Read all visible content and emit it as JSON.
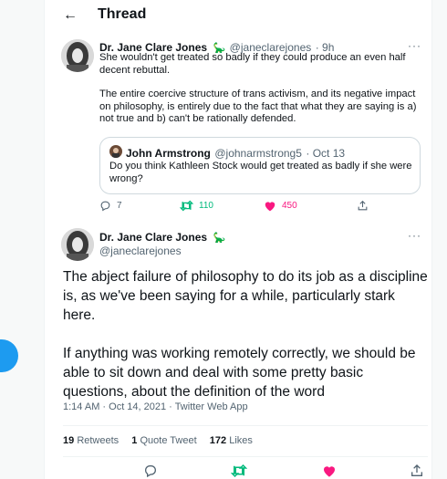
{
  "header": {
    "back_label": "←",
    "title": "Thread"
  },
  "tweet_parent": {
    "name": "Dr. Jane Clare Jones",
    "badge": "🦕",
    "handle": "@janeclarejones",
    "time": "· 9h",
    "more": "···",
    "paragraphs": [
      "She wouldn't get treated so badly if they could produce an even half decent rebuttal.",
      "The entire coercive structure of trans activism, and its negative impact on philosophy, is entirely due to the fact that what they are saying is a) not true and b) can't be rationally defended."
    ],
    "quote": {
      "name": "John Armstrong",
      "handle": "@johnarmstrong5",
      "time": "· Oct 13",
      "text": "Do you think Kathleen Stock would get treated as badly if she were wrong?"
    },
    "actions": {
      "replies": "7",
      "retweets": "110",
      "likes": "450"
    }
  },
  "tweet_main": {
    "name": "Dr. Jane Clare Jones",
    "badge": "🦕",
    "handle": "@janeclarejones",
    "more": "···",
    "paragraphs": [
      "The abject failure of philosophy to do its job as a discipline is, as we've been saying for a while, particularly stark here.",
      "If anything was working remotely correctly, we should be able to sit down and deal with some pretty basic questions, about the definition of the word"
    ],
    "meta": "1:14 AM · Oct 14, 2021 · Twitter Web App",
    "stats": {
      "retweets_count": "19",
      "retweets_label": "Retweets",
      "quotes_count": "1",
      "quotes_label": "Quote Tweet",
      "likes_count": "172",
      "likes_label": "Likes"
    }
  },
  "colors": {
    "accent": "#1d9bf0",
    "retweet": "#00ba7c",
    "like": "#f91880",
    "muted": "#536471"
  },
  "icons": [
    "back-arrow-icon",
    "reply-icon",
    "retweet-icon",
    "like-icon",
    "share-icon",
    "more-icon",
    "dinosaur-badge-icon"
  ]
}
